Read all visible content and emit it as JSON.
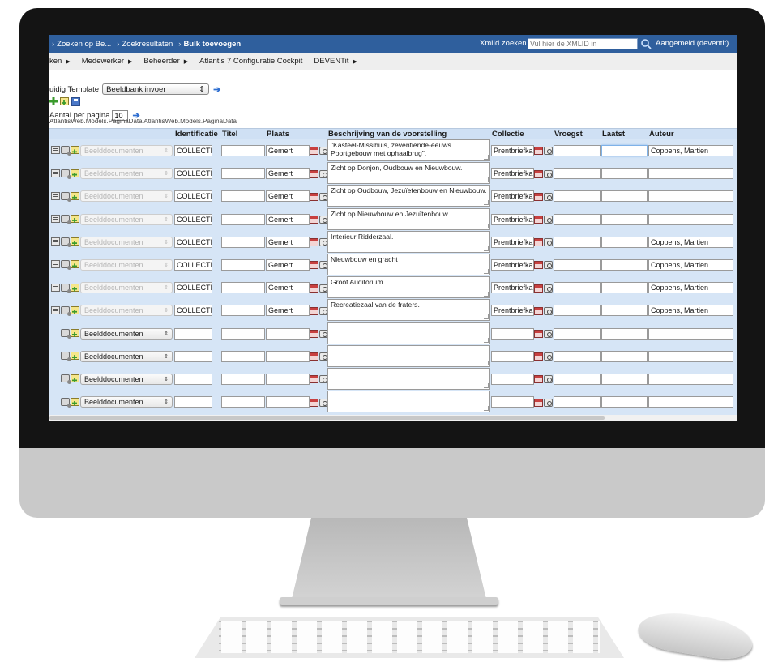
{
  "breadcrumb": {
    "items": [
      "Zoeken op Be...",
      "Zoekresultaten"
    ],
    "current": "Bulk toevoegen",
    "separator": "›"
  },
  "xmlid": {
    "label": "XmlId zoeken",
    "placeholder": "Vul hier de XMLID in"
  },
  "login": {
    "text": "Aangemeld (deventit)"
  },
  "menu": {
    "items": [
      {
        "label": "ken"
      },
      {
        "label": "Medewerker"
      },
      {
        "label": "Beheerder"
      },
      {
        "label": "Atlantis 7 Configuratie Cockpit",
        "no_arrow": true
      },
      {
        "label": "DEVENTit"
      }
    ]
  },
  "template": {
    "label": "uidig Template",
    "selected": "Beeldbank invoer"
  },
  "perpage": {
    "label": "Aantal per pagina",
    "value": "10"
  },
  "model_text": "AtlantisWeb.Models.PaginaData AtlantisWeb.Models.PaginaData",
  "grid": {
    "headers": {
      "identificatie": "Identificatie",
      "titel": "Titel",
      "plaats": "Plaats",
      "beschrijving": "Beschrijving van de voorstelling",
      "collectie": "Collectie",
      "vroegst": "Vroegst",
      "laatst": "Laatst",
      "auteur": "Auteur"
    },
    "rows": [
      {
        "type": "Beelddocumenten",
        "ident": "COLLECTI",
        "titel": "",
        "plaats": "Gemert",
        "beschrijving": "\"Kasteel-Missihuis, zeventiende-eeuws Poortgebouw met ophaalbrug\".",
        "collectie": "Prentbriefka",
        "vroegst": "",
        "laatst": "",
        "auteur": "Coppens, Martien"
      },
      {
        "type": "Beelddocumenten",
        "ident": "COLLECTI",
        "titel": "",
        "plaats": "Gemert",
        "beschrijving": "Zicht op Donjon, Oudbouw en Nieuwbouw.",
        "collectie": "Prentbriefka",
        "vroegst": "",
        "laatst": "",
        "auteur": ""
      },
      {
        "type": "Beelddocumenten",
        "ident": "COLLECTI",
        "titel": "",
        "plaats": "Gemert",
        "beschrijving": "Zicht op  Oudbouw, Jezuïetenbouw en Nieuwbouw.",
        "collectie": "Prentbriefka",
        "vroegst": "",
        "laatst": "",
        "auteur": ""
      },
      {
        "type": "Beelddocumenten",
        "ident": "COLLECTI",
        "titel": "",
        "plaats": "Gemert",
        "beschrijving": "Zicht op Nieuwbouw en Jezuïtenbouw.",
        "collectie": "Prentbriefka",
        "vroegst": "",
        "laatst": "",
        "auteur": ""
      },
      {
        "type": "Beelddocumenten",
        "ident": "COLLECTI",
        "titel": "",
        "plaats": "Gemert",
        "beschrijving": "Interieur Ridderzaal.",
        "collectie": "Prentbriefka",
        "vroegst": "",
        "laatst": "",
        "auteur": "Coppens, Martien"
      },
      {
        "type": "Beelddocumenten",
        "ident": "COLLECTI",
        "titel": "",
        "plaats": "Gemert",
        "beschrijving": "Nieuwbouw en gracht",
        "collectie": "Prentbriefka",
        "vroegst": "",
        "laatst": "",
        "auteur": "Coppens, Martien"
      },
      {
        "type": "Beelddocumenten",
        "ident": "COLLECTI",
        "titel": "",
        "plaats": "Gemert",
        "beschrijving": "Groot Auditorium",
        "collectie": "Prentbriefka",
        "vroegst": "",
        "laatst": "",
        "auteur": "Coppens, Martien"
      },
      {
        "type": "Beelddocumenten",
        "ident": "COLLECTI",
        "titel": "",
        "plaats": "Gemert",
        "beschrijving": "Recreatiezaal van de fraters.",
        "collectie": "Prentbriefka",
        "vroegst": "",
        "laatst": "",
        "auteur": "Coppens, Martien"
      },
      {
        "type": "Beelddocumenten",
        "ident": "",
        "titel": "",
        "plaats": "",
        "beschrijving": "",
        "collectie": "",
        "vroegst": "",
        "laatst": "",
        "auteur": "",
        "new": true
      },
      {
        "type": "Beelddocumenten",
        "ident": "",
        "titel": "",
        "plaats": "",
        "beschrijving": "",
        "collectie": "",
        "vroegst": "",
        "laatst": "",
        "auteur": "",
        "new": true
      },
      {
        "type": "Beelddocumenten",
        "ident": "",
        "titel": "",
        "plaats": "",
        "beschrijving": "",
        "collectie": "",
        "vroegst": "",
        "laatst": "",
        "auteur": "",
        "new": true
      },
      {
        "type": "Beelddocumenten",
        "ident": "",
        "titel": "",
        "plaats": "",
        "beschrijving": "",
        "collectie": "",
        "vroegst": "",
        "laatst": "",
        "auteur": "",
        "new": true
      }
    ]
  },
  "colors": {
    "topbar": "#2f5f9d",
    "grid_header": "#cfe0f4",
    "grid_body": "#d6e5f6",
    "menubar": "#eeeeee"
  }
}
